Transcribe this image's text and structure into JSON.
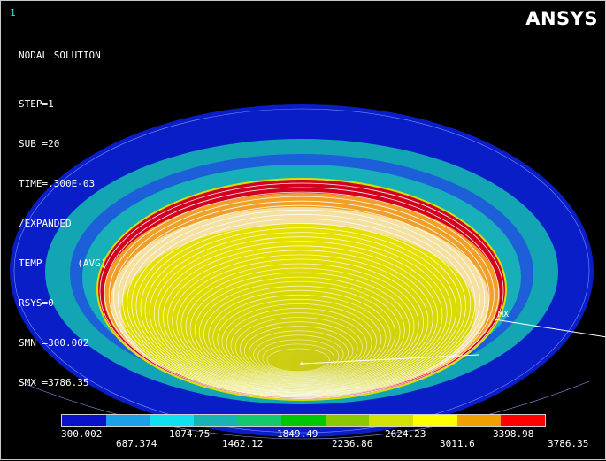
{
  "window": {
    "number": "1",
    "brand": "ANSYS"
  },
  "info": {
    "title": "NODAL SOLUTION",
    "lines": [
      "STEP=1",
      "SUB =20",
      "TIME=.300E-03",
      "/EXPANDED",
      "TEMP      (AVG)",
      "RSYS=0",
      "SMN =300.002",
      "SMX =3786.35"
    ]
  },
  "plot": {
    "max_marker": "MX",
    "colors": {
      "background": "#000000",
      "disk_outer": "#0a1ec8",
      "ring_teal": "#14a5b4",
      "rim_red": "#d2001e",
      "rim_orange": "#f0a028",
      "bowl_yellow": "#e0e000",
      "bowl_center": "#c8c814",
      "contour_lines": "#ffffff"
    }
  },
  "legend": {
    "band_colors": [
      "#0a10c8",
      "#1ea0e6",
      "#10e0f0",
      "#18b4b4",
      "#14c86e",
      "#00c800",
      "#8cc800",
      "#d2e100",
      "#ffff00",
      "#f0a000",
      "#ff0000"
    ],
    "labels_top": [
      "300.002",
      "1074.75",
      "1849.49",
      "2624.23",
      "3398.98"
    ],
    "labels_bottom": [
      "687.374",
      "1462.12",
      "2236.86",
      "3011.6",
      "3786.35"
    ]
  }
}
